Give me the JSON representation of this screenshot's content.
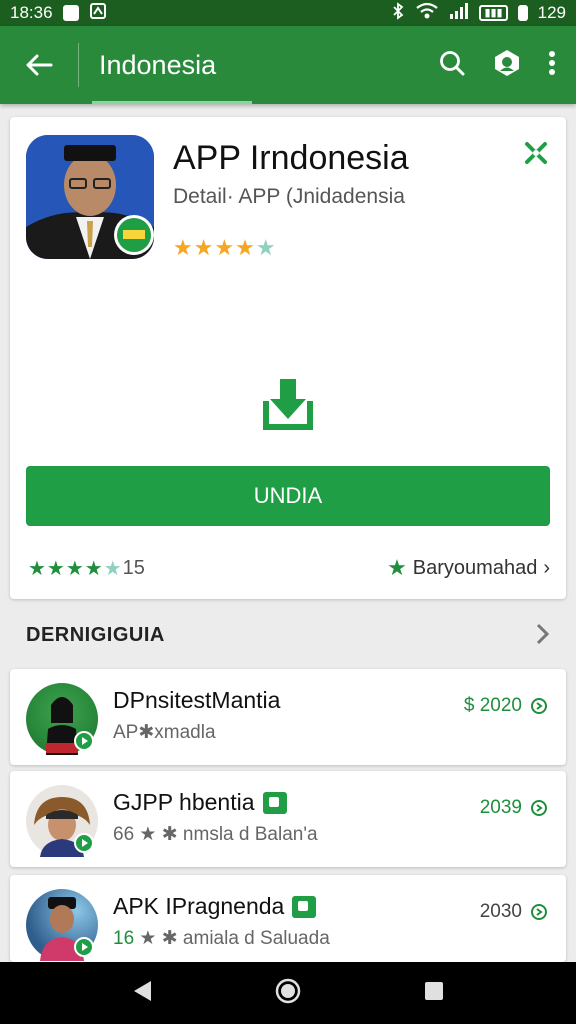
{
  "status_bar": {
    "time": "18:36",
    "battery": "129"
  },
  "app_bar": {
    "title": "Indonesia"
  },
  "app": {
    "name": "APP Irndonesia",
    "subtitle": "Detail· APP (Jnidadensia",
    "install_label": "UNDIA",
    "rating_count": "15",
    "developer": "Baryoumahad"
  },
  "section": {
    "title": "DERNIGIGUIA"
  },
  "items": [
    {
      "name": "DPnsitestMantia",
      "sub": "AP✱xmadla",
      "value": "$ 2020"
    },
    {
      "name": "GJPP hbentia",
      "sub_prefix": "66",
      "sub": "★ ✱ nmsla d Balan'a",
      "value": "2039"
    },
    {
      "name": "APK IPragnenda",
      "sub_prefix": "16",
      "sub": "★ ✱ amiala d Saluada",
      "value": "2030"
    }
  ],
  "colors": {
    "primary": "#2a8a3c",
    "status": "#1b5e20",
    "accent": "#1f9e45",
    "star": "#f6a623"
  }
}
